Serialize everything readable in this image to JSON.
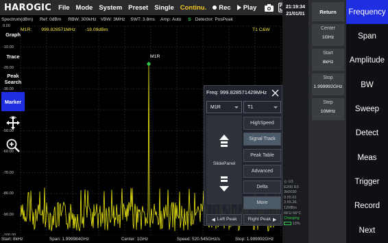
{
  "app": {
    "logo": "HAROGIC",
    "menu": [
      "File",
      "Mode",
      "System",
      "Preset",
      "Single"
    ],
    "continuous_label": "Continu.",
    "rec_label": "Rec",
    "play_label": "Play"
  },
  "info_row": {
    "spectrum": "Spectrum(dBm)",
    "ref": "Ref: 0dBm",
    "rbw": "RBW: 300kHz",
    "vbw": "VBW: 3MHz",
    "swt": "SWT: 3.8ms",
    "amp": "Amp: Auto",
    "s_badge": "S",
    "detector": "Detector: PosPeak"
  },
  "plot": {
    "marker_name": "M1R:",
    "marker_freq": "999.828571MHz",
    "marker_level": "-18.09dBm",
    "trace_badge": "T1 C&W",
    "marker_label": "M1R",
    "trace_color": "#f4f014",
    "marker_color": "#2ec94a",
    "y_labels": [
      "0.00",
      "-10.00",
      "-20.00",
      "-30.00",
      "-40.00",
      "-50.00",
      "-60.00",
      "-70.00",
      "-80.00",
      "-90.00",
      "-100.00"
    ]
  },
  "bottom": {
    "start": "Start: 8kHz",
    "span": "Span: 1.999984GHz",
    "center": "Center: 1GHz",
    "speed": "Speed: 520.545GHz/s",
    "stop": "Stop: 1.999992GHz"
  },
  "popup": {
    "title": "Freq: 999.828571429MHz",
    "marker_select": "M1R",
    "trace_select": "T1",
    "slide_panel": "SlidePanel",
    "buttons": [
      "HighSpeed",
      "Signal Track",
      "Peak Table",
      "Advanced",
      "Delta",
      "More"
    ],
    "active_buttons": [
      "Signal Track",
      "More"
    ],
    "left_peak": "Left Peak",
    "right_peak": "Right Peak"
  },
  "mid_column": {
    "graph": "Graph",
    "trace": "Trace",
    "peak_search": "Peak Search",
    "marker": "Marker",
    "marker_active": true
  },
  "status": {
    "u3": "U3",
    "lines": [
      "E200 R3",
      "3b0030",
      "0.55.61",
      "3.55.26",
      "12MB/s",
      "RFU 56°C",
      "Charging"
    ],
    "battery": "13%"
  },
  "clock": {
    "time": "21:19:34",
    "date": "21/01/01"
  },
  "softkeys": {
    "return": "Return",
    "items": [
      {
        "title": "Center",
        "value": "1GHz"
      },
      {
        "title": "Start",
        "value": "8kHz"
      },
      {
        "title": "Stop",
        "value": "1.999992GHz"
      },
      {
        "title": "Step",
        "value": "10MHz"
      }
    ]
  },
  "right_menu": {
    "items": [
      "Frequency",
      "Span",
      "Amplitude",
      "BW",
      "Sweep",
      "Detect",
      "Meas",
      "Trigger",
      "Record",
      "Next"
    ],
    "active": "Frequency"
  }
}
